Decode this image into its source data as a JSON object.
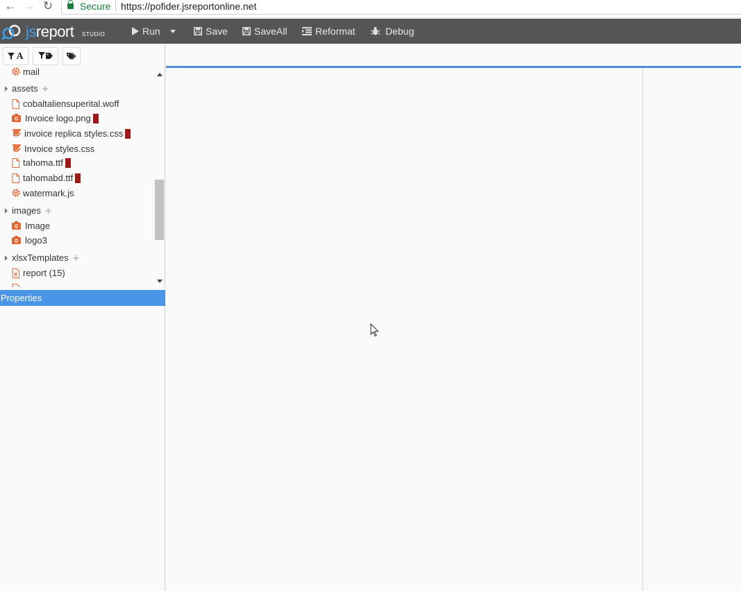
{
  "browser": {
    "secure_label": "Secure",
    "url": "https://pofider.jsreportonline.net"
  },
  "app": {
    "logo_js": "js",
    "logo_report": "report",
    "logo_studio": "STUDIO"
  },
  "toolbar": {
    "run_label": "Run",
    "save_label": "Save",
    "saveall_label": "SaveAll",
    "reformat_label": "Reformat",
    "debug_label": "Debug"
  },
  "filters": {
    "name_filter_label": "A",
    "tag_filter_icon": "filter-tag-icon",
    "tags_icon": "tags-icon"
  },
  "tree": {
    "mail": "mail",
    "assets": "assets",
    "cobalt": "cobaltaliensuperital.woff",
    "invoice_logo": "Invoice logo.png",
    "invoice_replica": "invoice replica styles.css",
    "invoice_styles": "Invoice styles.css",
    "tahoma": "tahoma.ttf",
    "tahomabd": "tahomabd.ttf",
    "watermark": "watermark.js",
    "images": "images",
    "image": "Image",
    "logo3": "logo3",
    "xlsx": "xlsxTemplates",
    "report": "report (15)"
  },
  "panels": {
    "properties_label": "Properties"
  },
  "colors": {
    "toolbar_bg": "#555555",
    "accent": "#4a95e8",
    "lock_marker": "#a01818",
    "file_icon": "#e8642c"
  }
}
